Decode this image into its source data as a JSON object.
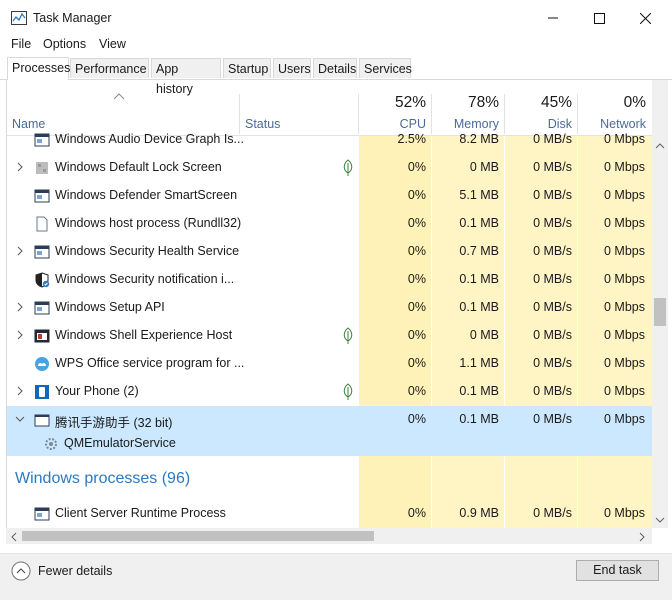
{
  "window": {
    "title": "Task Manager"
  },
  "menu": [
    "File",
    "Options",
    "View"
  ],
  "tabs": [
    "Processes",
    "Performance",
    "App history",
    "Startup",
    "Users",
    "Details",
    "Services"
  ],
  "headers": {
    "name": "Name",
    "status": "Status",
    "cpu": {
      "pct": "52%",
      "label": "CPU"
    },
    "memory": {
      "pct": "78%",
      "label": "Memory"
    },
    "disk": {
      "pct": "45%",
      "label": "Disk"
    },
    "network": {
      "pct": "0%",
      "label": "Network"
    }
  },
  "rows": [
    {
      "name": "Windows Audio Device Graph Is...",
      "cpu": "2.5%",
      "memory": "8.2 MB",
      "disk": "0 MB/s",
      "network": "0 Mbps"
    },
    {
      "name": "Windows Default Lock Screen",
      "cpu": "0%",
      "memory": "0 MB",
      "disk": "0 MB/s",
      "network": "0 Mbps"
    },
    {
      "name": "Windows Defender SmartScreen",
      "cpu": "0%",
      "memory": "5.1 MB",
      "disk": "0 MB/s",
      "network": "0 Mbps"
    },
    {
      "name": "Windows host process (Rundll32)",
      "cpu": "0%",
      "memory": "0.1 MB",
      "disk": "0 MB/s",
      "network": "0 Mbps"
    },
    {
      "name": "Windows Security Health Service",
      "cpu": "0%",
      "memory": "0.7 MB",
      "disk": "0 MB/s",
      "network": "0 Mbps"
    },
    {
      "name": "Windows Security notification i...",
      "cpu": "0%",
      "memory": "0.1 MB",
      "disk": "0 MB/s",
      "network": "0 Mbps"
    },
    {
      "name": "Windows Setup API",
      "cpu": "0%",
      "memory": "0.1 MB",
      "disk": "0 MB/s",
      "network": "0 Mbps"
    },
    {
      "name": "Windows Shell Experience Host",
      "cpu": "0%",
      "memory": "0 MB",
      "disk": "0 MB/s",
      "network": "0 Mbps"
    },
    {
      "name": "WPS Office service program for ...",
      "cpu": "0%",
      "memory": "1.1 MB",
      "disk": "0 MB/s",
      "network": "0 Mbps"
    },
    {
      "name": "Your Phone (2)",
      "cpu": "0%",
      "memory": "0.1 MB",
      "disk": "0 MB/s",
      "network": "0 Mbps"
    },
    {
      "name": "腾讯手游助手 (32 bit)",
      "cpu": "0%",
      "memory": "0.1 MB",
      "disk": "0 MB/s",
      "network": "0 Mbps"
    },
    {
      "name": "QMEmulatorService"
    }
  ],
  "group": {
    "title": "Windows processes (96)"
  },
  "last_row": {
    "name": "Client Server Runtime Process",
    "cpu": "0%",
    "memory": "0.9 MB",
    "disk": "0 MB/s",
    "network": "0 Mbps"
  },
  "footer": {
    "fewer_details": "Fewer details",
    "end_task": "End task"
  }
}
